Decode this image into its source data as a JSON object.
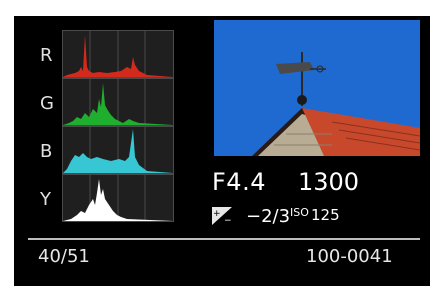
{
  "histograms": [
    {
      "label": "R",
      "color": "#d42a1c"
    },
    {
      "label": "G",
      "color": "#1fae2e"
    },
    {
      "label": "B",
      "color": "#36c6d4"
    },
    {
      "label": "Y",
      "color": "#ffffff"
    }
  ],
  "exposure": {
    "aperture": "F4.4",
    "shutter": "1300",
    "ev_compensation": "−2/3",
    "iso_label": "ISO",
    "iso_value": "125"
  },
  "footer": {
    "counter": "40/51",
    "file_number": "100-0041"
  },
  "icons": {
    "exposure_compensation": "exposure-compensation-icon"
  },
  "colors": {
    "sky": "#1e6ad0",
    "roof": "#c8482c"
  }
}
